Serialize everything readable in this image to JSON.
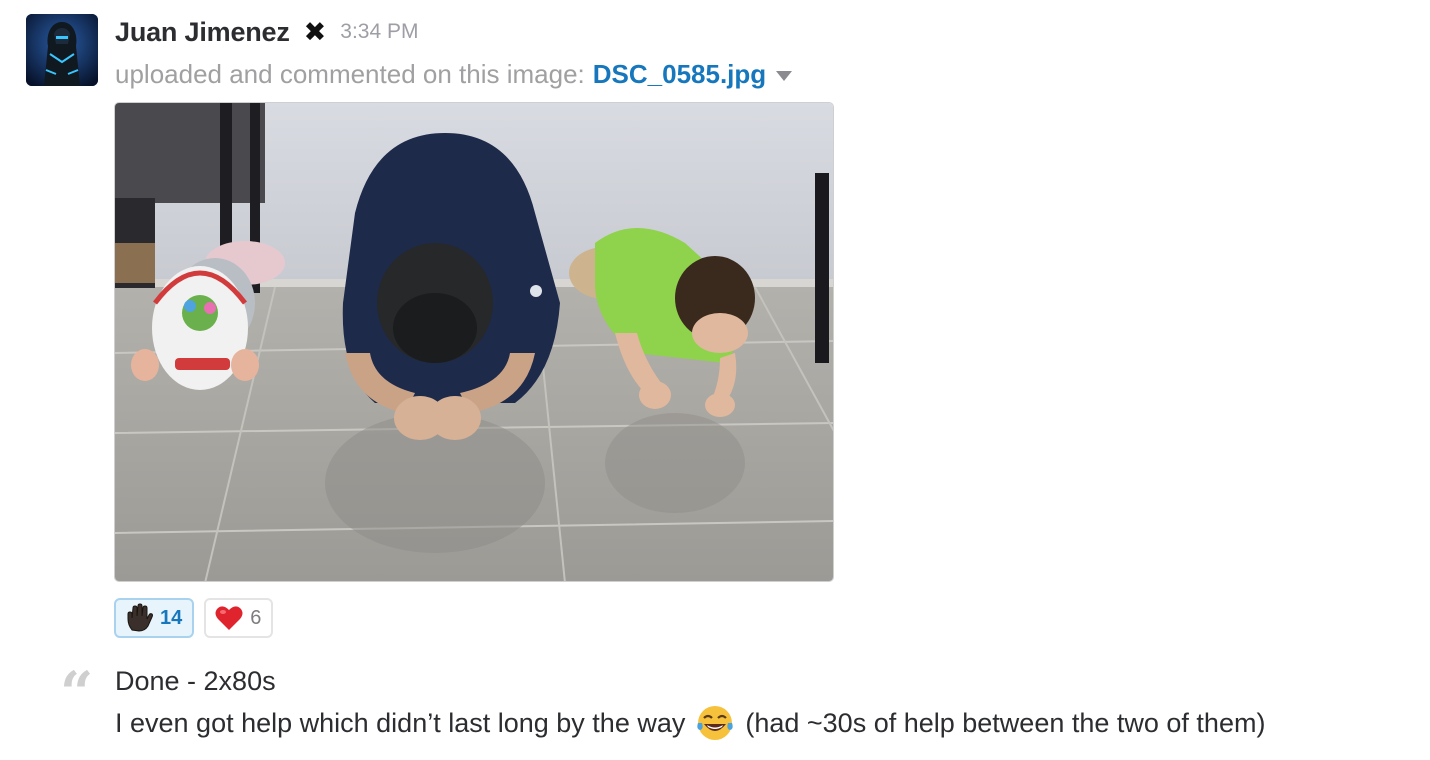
{
  "message": {
    "author": "Juan Jimenez",
    "status_icon": "heavy-x-icon",
    "status_glyph": "✖",
    "timestamp": "3:34 PM",
    "action_text": "uploaded and commented on this image:",
    "file_name": "DSC_0585.jpg",
    "avatar_icon": "avatar-icon",
    "image_icon": "photo-planking-family"
  },
  "reactions": [
    {
      "icon": "raised-hand-icon",
      "count": "14",
      "active": true
    },
    {
      "icon": "red-heart-icon",
      "count": "6",
      "active": false
    }
  ],
  "comment": {
    "line1": "Done - 2x80s",
    "line2_before": "I even got help which didn’t last long by the way",
    "line2_emoji": "tears-of-joy-emoji-icon",
    "line2_after": "(had ~30s of help between the two of them)"
  },
  "colors": {
    "link": "#1677bd",
    "muted": "#a0a0a2",
    "text": "#2c2d30",
    "reaction_active_bg": "#e8f4fb"
  }
}
